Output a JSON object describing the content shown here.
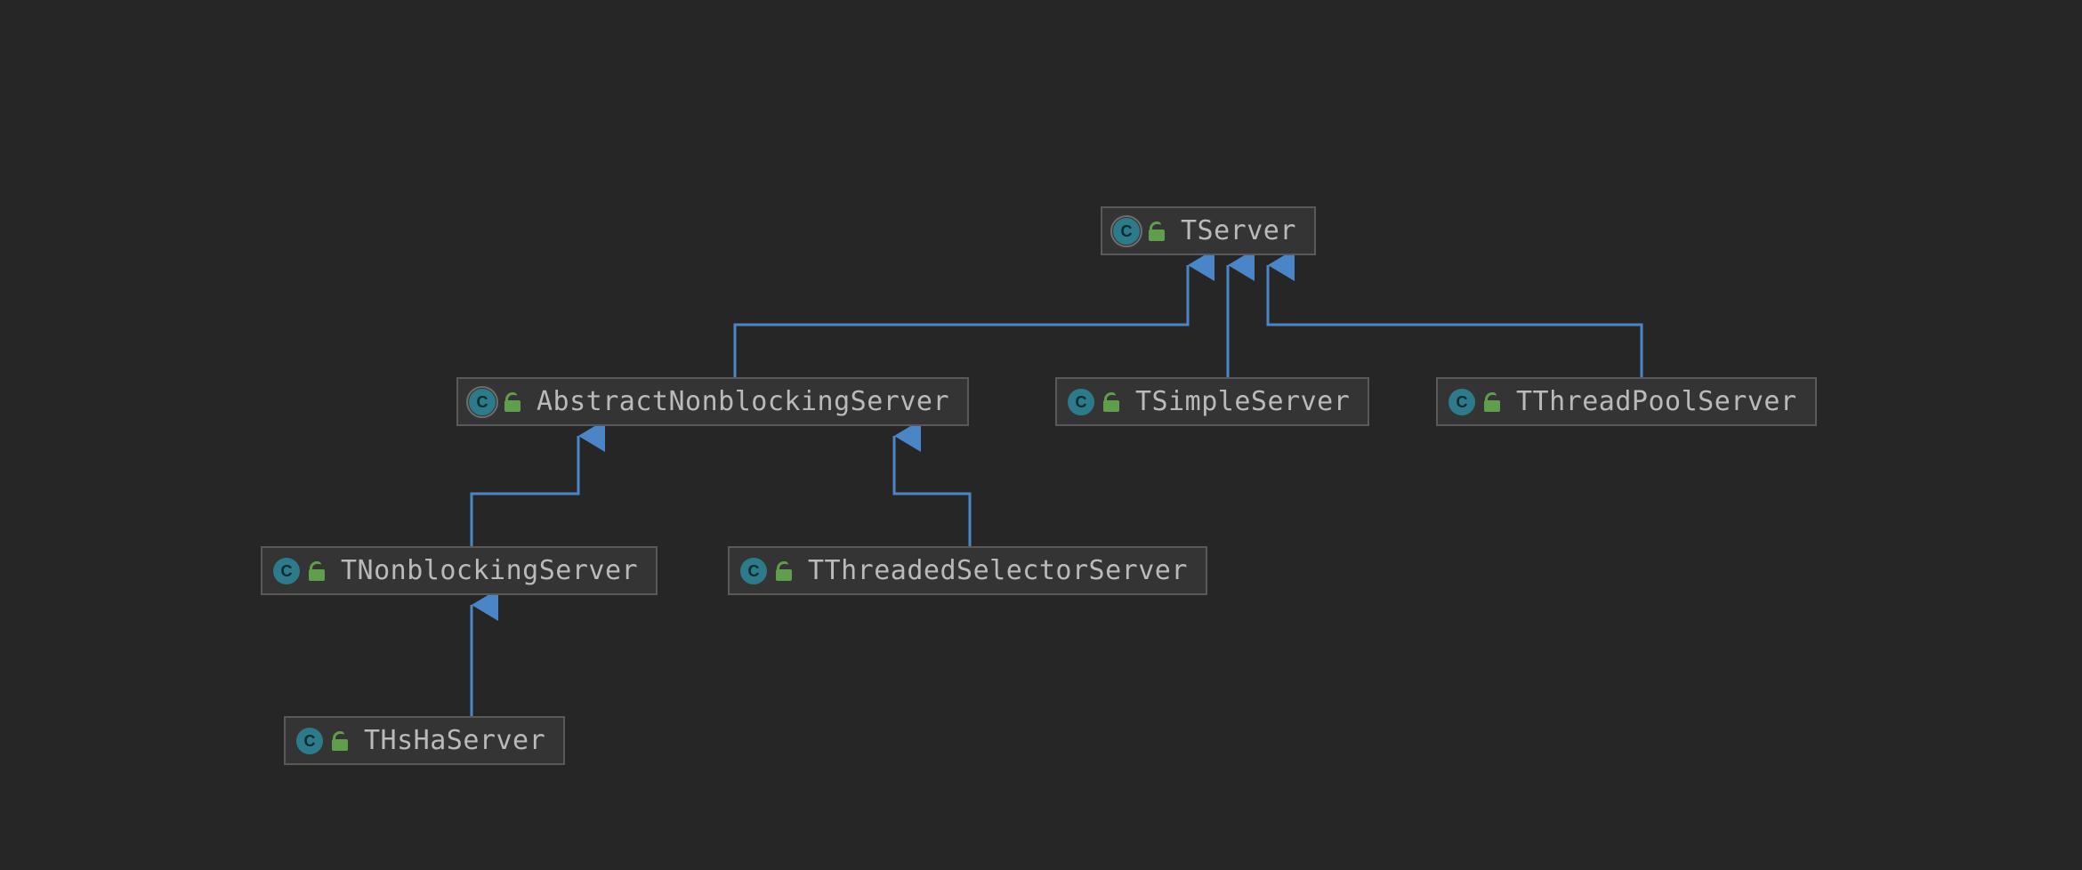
{
  "diagram": {
    "class_letter": "C",
    "nodes": {
      "tserver": {
        "label": "TServer",
        "abstract": true
      },
      "abstractnb": {
        "label": "AbstractNonblockingServer",
        "abstract": true
      },
      "tsimple": {
        "label": "TSimpleServer",
        "abstract": false
      },
      "tthreadpool": {
        "label": "TThreadPoolServer",
        "abstract": false
      },
      "tnonblocking": {
        "label": "TNonblockingServer",
        "abstract": false
      },
      "tthreadedsel": {
        "label": "TThreadedSelectorServer",
        "abstract": false
      },
      "thsha": {
        "label": "THsHaServer",
        "abstract": false
      }
    },
    "edges": [
      {
        "from": "abstractnb",
        "to": "tserver"
      },
      {
        "from": "tsimple",
        "to": "tserver"
      },
      {
        "from": "tthreadpool",
        "to": "tserver"
      },
      {
        "from": "tnonblocking",
        "to": "abstractnb"
      },
      {
        "from": "tthreadedsel",
        "to": "abstractnb"
      },
      {
        "from": "thsha",
        "to": "tnonblocking"
      }
    ],
    "colors": {
      "background": "#262626",
      "node_fill": "#343434",
      "node_border": "#595959",
      "text": "#bababa",
      "class_icon": "#2d7b8a",
      "lock_icon": "#5f9e4a",
      "connector": "#4a86c7"
    }
  }
}
